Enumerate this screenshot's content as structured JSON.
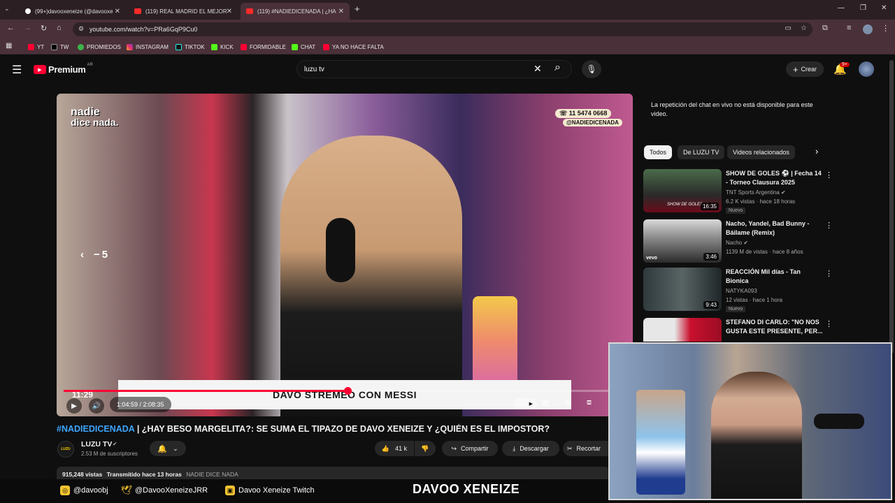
{
  "browser": {
    "tabs": [
      {
        "label": "(99+)davooxeneize (@davooxe"
      },
      {
        "label": "(119) REAL MADRID EL MEJOR"
      },
      {
        "label": "(119) #NADIEDICENADA | ¿HA"
      }
    ],
    "new_tab": "+",
    "url": "youtube.com/watch?v=PRa6GqP9Cu0",
    "bookmarks": [
      "YT",
      "TW",
      "PROMIEDOS",
      "INSTAGRAM",
      "TIKTOK",
      "KICK",
      "FORMIDABLE",
      "CHAT",
      "YA NO HACE FALTA"
    ]
  },
  "youtube": {
    "logo_text": "Premium",
    "region": "AR",
    "search_value": "luzu tv",
    "create_label": "Crear",
    "notif_badge": "9+"
  },
  "video": {
    "brand_line1": "nadie",
    "brand_line2": "dice nada.",
    "phone": "11 5474 0668",
    "handle": "@NADIEDICENADA",
    "seek_label": "5",
    "clock": "11:29",
    "banner": "DAVO STREMEO CON MESSI",
    "time": "1:04:59 / 2:08:35",
    "progress": 0.505
  },
  "meta": {
    "hashtag": "#NADIEDICENADA",
    "title": " | ¿HAY BESO MARGELITA?: SE SUMA EL TIPAZO DE DAVO XENEIZE Y ¿QUIÉN ES EL IMPOSTOR?",
    "channel": "LUZU TV",
    "subs": "2.53 M de suscriptores",
    "likes": "41 k",
    "share": "Compartir",
    "download": "Descargar",
    "clip": "Recortar",
    "views": "915,248 vistas",
    "streamed": "Transmitido hace 13 horas",
    "show_tag": "NADIE DICE NADA"
  },
  "chat_notice": "La repetición del chat en vivo no está disponible para este video.",
  "chips": [
    "Todos",
    "De LUZU TV",
    "Videos relacionados"
  ],
  "recommendations": [
    {
      "title": "SHOW DE GOLES ⚽ | Fecha 14 - Torneo Clausura 2025",
      "channel": "TNT Sports Argentina",
      "stats": "6.2 K vistas · hace 18 horas",
      "badge": "Nuevo",
      "duration": "16:35",
      "thumb_text": "SHOW DE GOLES"
    },
    {
      "title": "Nacho, Yandel, Bad Bunny - Báilame (Remix)",
      "channel": "Nacho",
      "stats": "1139 M de vistas · hace 8 años",
      "badge": "",
      "duration": "3:46",
      "thumb_text": "vevo"
    },
    {
      "title": "REACCIÓN Mil días - Tan Bionica",
      "channel": "NATYKA093",
      "stats": "12 vistas · hace 1 hora",
      "badge": "Nuevo",
      "duration": "9:43",
      "thumb_text": ""
    },
    {
      "title": "STEFANO DI CARLO: \"NO NOS GUSTA ESTE PRESENTE, PER...",
      "channel": "",
      "stats": "",
      "badge": "",
      "duration": "",
      "thumb_text": ""
    }
  ],
  "overlay": {
    "instagram": "@davoobj",
    "twitter": "@DavooXeneizeJRR",
    "twitch": "Davoo Xeneize Twitch",
    "name": "DAVOO XENEIZE"
  },
  "colors": {
    "accent": "#ff0033",
    "hashtag": "#3ea6ff",
    "bg": "#0f0f0f"
  }
}
